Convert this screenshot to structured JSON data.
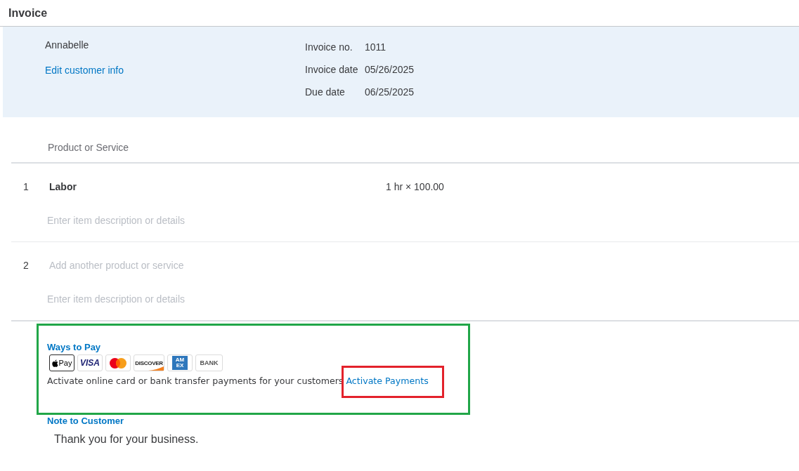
{
  "header": {
    "title": "Invoice"
  },
  "customer": {
    "name": "Annabelle",
    "edit_link": "Edit customer info"
  },
  "invoice_fields": [
    {
      "label": "Invoice no.",
      "value": "1011"
    },
    {
      "label": "Invoice date",
      "value": "05/26/2025"
    },
    {
      "label": "Due date",
      "value": "06/25/2025"
    }
  ],
  "line_items": {
    "columns": [
      "Product or Service"
    ],
    "rows": [
      {
        "number": "1",
        "product": {
          "value": "Labor"
        },
        "quantity_rate": "1 hr × 100.00",
        "description": {
          "placeholder": "Enter item description or details"
        }
      },
      {
        "number": "2",
        "product": {
          "placeholder": "Add another product or service"
        },
        "description": {
          "placeholder": "Enter item description or details"
        }
      }
    ]
  },
  "ways_to_pay": {
    "title": "Ways to Pay",
    "highlighted": true,
    "methods": [
      {
        "kind": "apple_pay",
        "label": "Pay"
      },
      {
        "kind": "visa",
        "label": "VISA"
      },
      {
        "kind": "mastercard"
      },
      {
        "kind": "discover",
        "label": "DISCOVER"
      },
      {
        "kind": "amex",
        "label": "AM EX"
      },
      {
        "kind": "bank",
        "label": "BANK"
      }
    ],
    "message": "Activate online card or bank transfer payments for your customers",
    "link": {
      "text": "Activate Payments",
      "highlighted": true
    }
  },
  "note": {
    "title": "Note to Customer",
    "value": "Thank you for your business."
  }
}
